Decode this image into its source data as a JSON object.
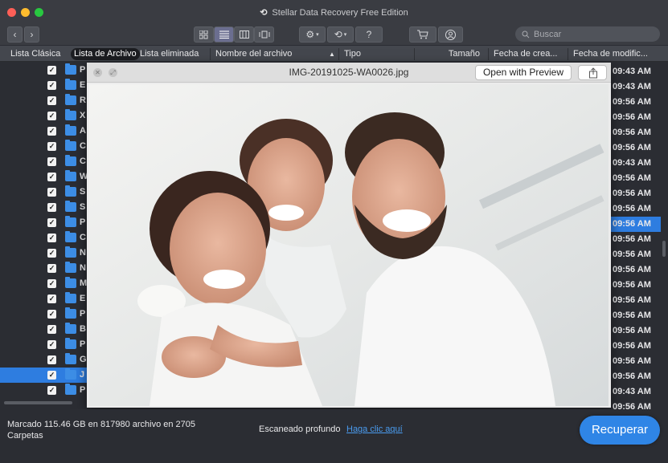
{
  "app": {
    "title": "Stellar Data Recovery Free Edition"
  },
  "toolbar": {
    "search_placeholder": "Buscar",
    "help_label": "?"
  },
  "tabs": [
    "Lista Clásica",
    "Lista de Archivo",
    "Lista eliminada"
  ],
  "columns": {
    "name": "Nombre del archivo",
    "type": "Tipo",
    "size": "Tamaño",
    "created": "Fecha de crea...",
    "modified": "Fecha de modific..."
  },
  "left_rows": [
    {
      "letter": "P",
      "checked": true,
      "selected": false
    },
    {
      "letter": "E",
      "checked": true,
      "selected": false
    },
    {
      "letter": "R",
      "checked": true,
      "selected": false
    },
    {
      "letter": "X",
      "checked": true,
      "selected": false
    },
    {
      "letter": "A",
      "checked": true,
      "selected": false
    },
    {
      "letter": "C",
      "checked": true,
      "selected": false
    },
    {
      "letter": "C",
      "checked": true,
      "selected": false
    },
    {
      "letter": "W",
      "checked": true,
      "selected": false
    },
    {
      "letter": "S",
      "checked": true,
      "selected": false
    },
    {
      "letter": "S",
      "checked": true,
      "selected": false
    },
    {
      "letter": "P",
      "checked": true,
      "selected": false
    },
    {
      "letter": "C",
      "checked": true,
      "selected": false
    },
    {
      "letter": "N",
      "checked": true,
      "selected": false
    },
    {
      "letter": "N",
      "checked": true,
      "selected": false
    },
    {
      "letter": "M",
      "checked": true,
      "selected": false
    },
    {
      "letter": "E",
      "checked": true,
      "selected": false
    },
    {
      "letter": "P",
      "checked": true,
      "selected": false
    },
    {
      "letter": "B",
      "checked": true,
      "selected": false
    },
    {
      "letter": "P",
      "checked": true,
      "selected": false
    },
    {
      "letter": "G",
      "checked": true,
      "selected": false
    },
    {
      "letter": "J",
      "checked": true,
      "selected": true
    },
    {
      "letter": "P",
      "checked": true,
      "selected": false
    }
  ],
  "date_rows": [
    {
      "text": "09:43 AM",
      "selected": false
    },
    {
      "text": "09:43 AM",
      "selected": false
    },
    {
      "text": "09:56 AM",
      "selected": false
    },
    {
      "text": "09:56 AM",
      "selected": false
    },
    {
      "text": "09:56 AM",
      "selected": false
    },
    {
      "text": "09:56 AM",
      "selected": false
    },
    {
      "text": "09:43 AM",
      "selected": false
    },
    {
      "text": "09:56 AM",
      "selected": false
    },
    {
      "text": "09:56 AM",
      "selected": false
    },
    {
      "text": "09:56 AM",
      "selected": false
    },
    {
      "text": "09:56 AM",
      "selected": true
    },
    {
      "text": "09:56 AM",
      "selected": false
    },
    {
      "text": "09:56 AM",
      "selected": false
    },
    {
      "text": "09:56 AM",
      "selected": false
    },
    {
      "text": "09:56 AM",
      "selected": false
    },
    {
      "text": "09:56 AM",
      "selected": false
    },
    {
      "text": "09:56 AM",
      "selected": false
    },
    {
      "text": "09:56 AM",
      "selected": false
    },
    {
      "text": "09:56 AM",
      "selected": false
    },
    {
      "text": "09:56 AM",
      "selected": false
    },
    {
      "text": "09:56 AM",
      "selected": false
    },
    {
      "text": "09:43 AM",
      "selected": false
    },
    {
      "text": "09:56 AM",
      "selected": false
    }
  ],
  "quicklook": {
    "filename": "IMG-20191025-WA0026.jpg",
    "open_label": "Open with Preview"
  },
  "bottom": {
    "status_line1": "Marcado 115.46 GB en 817980 archivo en 2705",
    "status_line2": "Carpetas",
    "scan_label": "Escaneado profundo",
    "scan_link": "Haga clic aquí",
    "recover_label": "Recuperar"
  },
  "colors": {
    "accent": "#2e7de0",
    "recover_button": "#2f85e6",
    "link": "#4a9cf0"
  }
}
